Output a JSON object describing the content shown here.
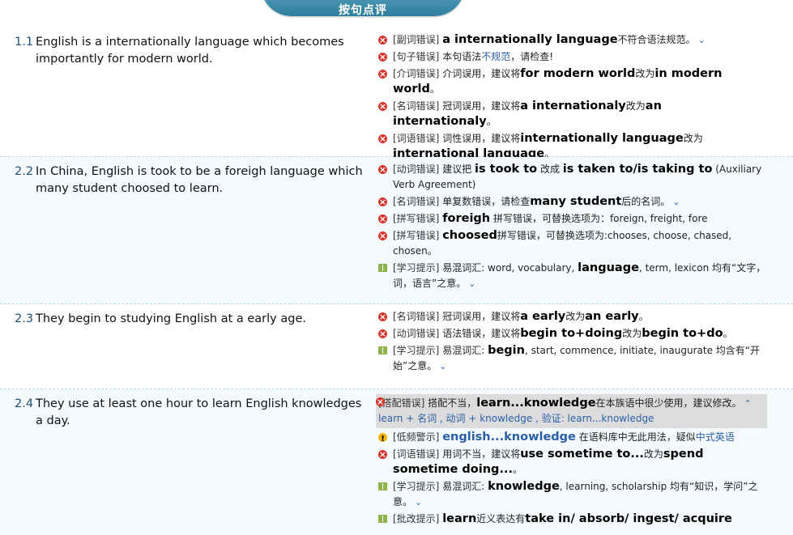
{
  "header": {
    "title": "按句点评"
  },
  "rows": [
    {
      "num": "1.1",
      "sentence": "English is a internationally language which becomes importantly for modern world.",
      "items": [
        {
          "tag": "[副词错误]",
          "p1": "",
          "b1": "a internationally language",
          "p2": "不符合语法规范。",
          "b2": "",
          "p3": "",
          "chev": "⌄"
        },
        {
          "tag": "[句子错误]",
          "p1": "本句语法",
          "link": "不规范",
          "p2": "，请检查!"
        },
        {
          "tag": "[介词错误]",
          "p1": "介词误用，建议将",
          "b1": "for modern world",
          "p2": "改为",
          "b2": "in modern world",
          "p3": "。"
        },
        {
          "tag": "[名词错误]",
          "p1": "冠词误用，建议将",
          "b1": "a internationaly",
          "p2": "改为",
          "b2": "an internationaly",
          "p3": "。"
        },
        {
          "tag": "[词语错误]",
          "p1": "词性误用，建议将",
          "b1": "internationally language",
          "p2": "改为",
          "b2": "international language",
          "p3": "。"
        }
      ]
    },
    {
      "num": "2.2",
      "sentence": "In China, English is took to be a foreigh language which many student choosed to learn.",
      "items": [
        {
          "tag": "[动词错误]",
          "p1": "建议把 ",
          "b1": "is took to",
          "p2": " 改成 ",
          "b2": "is taken to/is taking to",
          "p3": " (Auxiliary Verb Agreement)"
        },
        {
          "tag": "[名词错误]",
          "p1": "单复数错误，请检查",
          "b1": "many student",
          "p2": "后的名词。",
          "chev": "⌄"
        },
        {
          "tag": "[拼写错误]",
          "b1": "foreigh",
          "p2": " 拼写错误，可替换选项为：foreign, freight, fore"
        },
        {
          "tag": "[拼写错误]",
          "b1": "choosed",
          "p2": "拼写错误，可替换选项为:chooses, choose, chased, chosen。"
        },
        {
          "tag": "[学习提示]",
          "p1": "易混词汇: word, vocabulary, ",
          "b1": "language",
          "p2": ", term, lexicon 均有“文字，词，语言”之意。",
          "chev": "⌄"
        }
      ]
    },
    {
      "num": "2.3",
      "sentence": "They begin to studying English at a early age.",
      "items": [
        {
          "tag": "[名词错误]",
          "p1": "冠词误用，建议将",
          "b1": "a early",
          "p2": "改为",
          "b2": "an early",
          "p3": "。"
        },
        {
          "tag": "[动词错误]",
          "p1": "语法错误，建议将",
          "b1": "begin to+doing",
          "p2": "改为",
          "b2": "begin to+do",
          "p3": "。"
        },
        {
          "tag": "[学习提示]",
          "p1": "易混词汇: ",
          "b1": "begin",
          "p2": ", start, commence, initiate, inaugurate 均含有“开始”之意。",
          "chev": "⌄"
        }
      ]
    },
    {
      "num": "2.4",
      "sentence": "They use at least one hour to learn English knowledges a day.",
      "items": [
        {
          "tag": "[搭配错误]",
          "p1": "搭配不当，",
          "b1": "learn...knowledge",
          "p2": "在本族语中很少使用，建议修改。",
          "chev": "⌃",
          "extra": "learn + 名词 , 动词 + knowledge , 验证: learn...knowledge"
        },
        {
          "tag": "[低频警示]",
          "bl": "english...knowledge",
          "p2": " 在语料库中无此用法，疑似",
          "link2": "中式英语"
        },
        {
          "tag": "[词语错误]",
          "p1": "用词不当，建议将",
          "b1": "use sometime to...",
          "p2": "改为",
          "b2": "spend sometime doing...",
          "p3": "。"
        },
        {
          "tag": "[学习提示]",
          "p1": "易混词汇: ",
          "b1": "knowledge",
          "p2": ", learning, scholarship 均有“知识，学问”之意。",
          "chev": "⌄"
        },
        {
          "tag": "[批改提示]",
          "b1": "learn",
          "p2": "近义表达有",
          "b2": "take in/ absorb/ ingest/ acquire"
        }
      ]
    }
  ]
}
